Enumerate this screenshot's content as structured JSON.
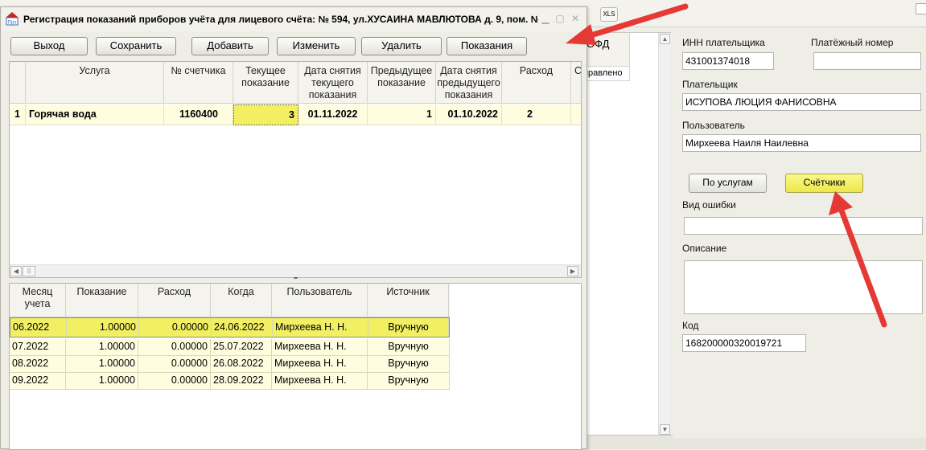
{
  "dialog": {
    "title": "Регистрация показаний приборов учёта для лицевого счёта: № 594, ул.ХУСАИНА МАВЛЮТОВА д. 9, пом.  №...",
    "logo_text": "Про"
  },
  "toolbar": {
    "exit": "Выход",
    "save": "Сохранить",
    "add": "Добавить",
    "edit": "Изменить",
    "delete": "Удалить",
    "readings": "Показания"
  },
  "meters_grid": {
    "columns": [
      "Услуга",
      "№ счетчика",
      "Текущее показание",
      "Дата снятия текущего показания",
      "Предыдущее показание",
      "Дата снятия предыдущего показания",
      "Расход",
      "С"
    ],
    "rows": [
      {
        "num": "1",
        "service": "Горячая вода",
        "meter_no": "1160400",
        "current": "3",
        "current_date": "01.11.2022",
        "previous": "1",
        "previous_date": "01.10.2022",
        "consumption": "2"
      }
    ]
  },
  "history_grid": {
    "columns": [
      "Месяц учета",
      "Показание",
      "Расход",
      "Когда",
      "Пользователь",
      "Источник"
    ],
    "rows": [
      {
        "month": "06.2022",
        "reading": "1.00000",
        "consumption": "0.00000",
        "when": "24.06.2022",
        "user": "Мирхеева Н. Н.",
        "source": "Вручную"
      },
      {
        "month": "07.2022",
        "reading": "1.00000",
        "consumption": "0.00000",
        "when": "25.07.2022",
        "user": "Мирхеева Н. Н.",
        "source": "Вручную"
      },
      {
        "month": "08.2022",
        "reading": "1.00000",
        "consumption": "0.00000",
        "when": "26.08.2022",
        "user": "Мирхеева Н. Н.",
        "source": "Вручную"
      },
      {
        "month": "09.2022",
        "reading": "1.00000",
        "consumption": "0.00000",
        "when": "28.09.2022",
        "user": "Мирхеева Н. Н.",
        "source": "Вручную"
      }
    ]
  },
  "background": {
    "xls": "XLS",
    "list_header": "ОФД",
    "list_cell": "правлено"
  },
  "right_panel": {
    "inn_label": "ИНН плательщика",
    "inn_value": "431001374018",
    "payment_no_label": "Платёжный номер",
    "payment_no_value": "",
    "payer_label": "Плательщик",
    "payer_value": "ИСУПОВА ЛЮЦИЯ ФАНИСОВНА",
    "user_label": "Пользователь",
    "user_value": "Мирхеева Наиля Наилевна",
    "by_services_btn": "По услугам",
    "meters_btn": "Счётчики",
    "error_type_label": "Вид ошибки",
    "error_type_value": "",
    "description_label": "Описание",
    "description_value": "",
    "code_label": "Код",
    "code_value": "168200000320019721"
  },
  "colors": {
    "arrow": "#e53935",
    "selected_yellow": "#f2ef63",
    "row_yellow": "#fffde0"
  }
}
